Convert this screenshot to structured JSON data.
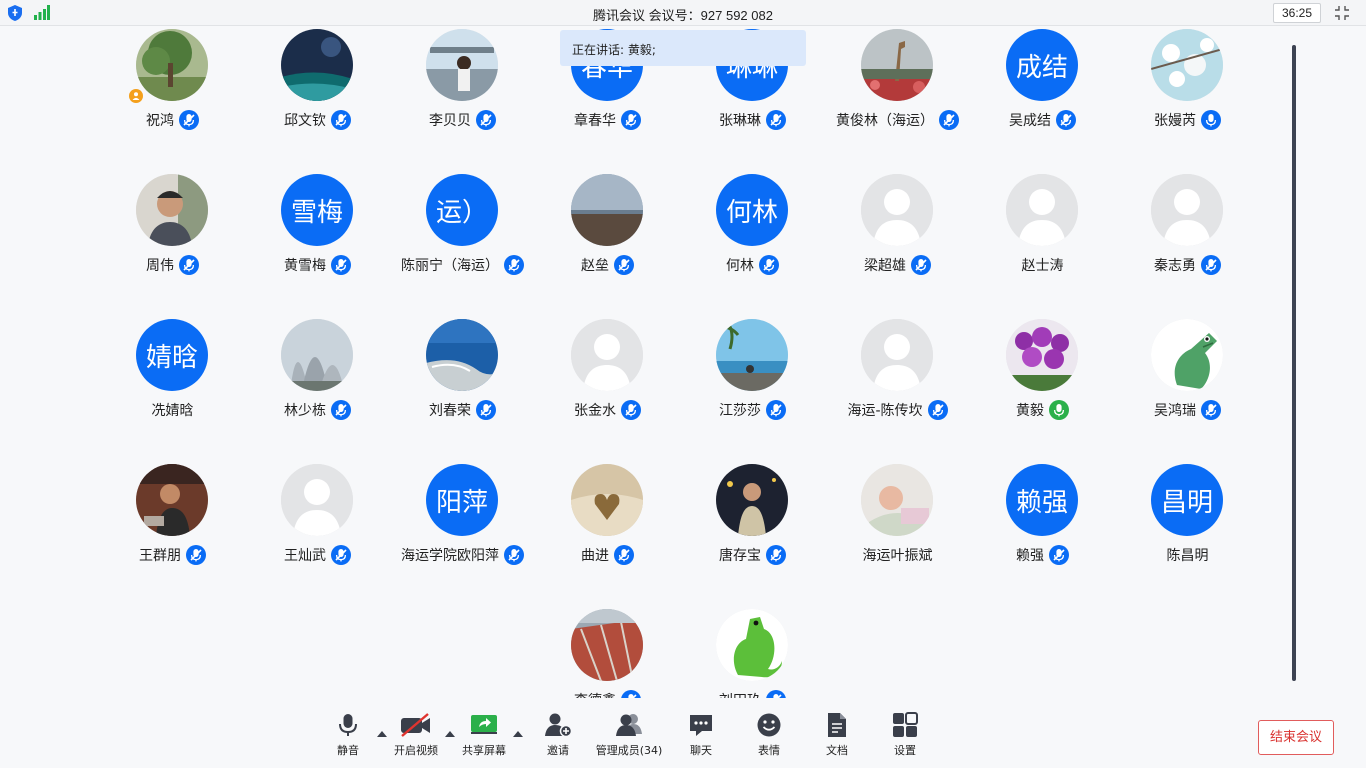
{
  "titlebar": {
    "title": "腾讯会议 会议号：927 592 082",
    "timer": "36:25"
  },
  "speaking": "正在讲话: 黄毅;",
  "participants": [
    {
      "name": "祝鸿",
      "avatar": "photo-tree",
      "mic": "muted",
      "host": true
    },
    {
      "name": "邱文钦",
      "avatar": "photo-night-sky",
      "mic": "muted"
    },
    {
      "name": "李贝贝",
      "avatar": "photo-woman-seaside",
      "mic": "muted"
    },
    {
      "name": "章春华",
      "avatar": "text",
      "avatar_text": "春华",
      "mic": "muted"
    },
    {
      "name": "张琳琳",
      "avatar": "text",
      "avatar_text": "琳琳",
      "mic": "muted"
    },
    {
      "name": "黄俊林（海运）",
      "avatar": "photo-giraffe-statue",
      "mic": "muted"
    },
    {
      "name": "吴成结",
      "avatar": "text",
      "avatar_text": "成结",
      "mic": "muted"
    },
    {
      "name": "张嫚芮",
      "avatar": "photo-blossom",
      "mic": "on"
    },
    {
      "name": "周伟",
      "avatar": "photo-man-portrait",
      "mic": "muted"
    },
    {
      "name": "黄雪梅",
      "avatar": "text",
      "avatar_text": "雪梅",
      "mic": "muted"
    },
    {
      "name": "陈丽宁（海运）",
      "avatar": "text",
      "avatar_text": "运）",
      "mic": "muted"
    },
    {
      "name": "赵垒",
      "avatar": "photo-sea-horizon",
      "mic": "muted"
    },
    {
      "name": "何林",
      "avatar": "text",
      "avatar_text": "何林",
      "mic": "muted"
    },
    {
      "name": "梁超雄",
      "avatar": "default",
      "mic": "muted"
    },
    {
      "name": "赵士涛",
      "avatar": "default",
      "mic": "none"
    },
    {
      "name": "秦志勇",
      "avatar": "default",
      "mic": "muted"
    },
    {
      "name": "冼婧晗",
      "avatar": "text",
      "avatar_text": "婧晗",
      "mic": "none"
    },
    {
      "name": "林少栋",
      "avatar": "photo-opera-house",
      "mic": "muted"
    },
    {
      "name": "刘春荣",
      "avatar": "photo-island-aerial",
      "mic": "muted"
    },
    {
      "name": "张金水",
      "avatar": "default",
      "mic": "muted"
    },
    {
      "name": "江莎莎",
      "avatar": "photo-beach-palm",
      "mic": "muted"
    },
    {
      "name": "海运-陈传坎",
      "avatar": "default",
      "mic": "muted"
    },
    {
      "name": "黄毅",
      "avatar": "photo-orchids",
      "mic": "speaking"
    },
    {
      "name": "吴鸿瑞",
      "avatar": "photo-crocodile-cartoon",
      "mic": "muted"
    },
    {
      "name": "王群朋",
      "avatar": "photo-man-reading",
      "mic": "muted"
    },
    {
      "name": "王灿武",
      "avatar": "default",
      "mic": "muted"
    },
    {
      "name": "海运学院欧阳萍",
      "avatar": "text",
      "avatar_text": "阳萍",
      "mic": "muted"
    },
    {
      "name": "曲进",
      "avatar": "photo-book-heart",
      "mic": "muted"
    },
    {
      "name": "唐存宝",
      "avatar": "photo-man-night",
      "mic": "muted"
    },
    {
      "name": "海运叶振斌",
      "avatar": "photo-baby",
      "mic": "none"
    },
    {
      "name": "赖强",
      "avatar": "text",
      "avatar_text": "赖强",
      "mic": "muted"
    },
    {
      "name": "陈昌明",
      "avatar": "text",
      "avatar_text": "昌明",
      "mic": "none"
    },
    {
      "name": "李德鑫",
      "avatar": "photo-ship-deck",
      "mic": "muted"
    },
    {
      "name": "刘田玖",
      "avatar": "photo-green-dinosaur",
      "mic": "muted"
    }
  ],
  "toolbar": {
    "items": [
      {
        "id": "mute",
        "label": "静音",
        "icon": "microphone-icon",
        "caret": true
      },
      {
        "id": "video",
        "label": "开启视频",
        "icon": "camera-off-icon",
        "caret": true
      },
      {
        "id": "share",
        "label": "共享屏幕",
        "icon": "share-screen-icon",
        "caret": true
      },
      {
        "id": "invite",
        "label": "邀请",
        "icon": "invite-user-icon"
      },
      {
        "id": "members",
        "label": "管理成员(34)",
        "icon": "members-icon"
      },
      {
        "id": "chat",
        "label": "聊天",
        "icon": "chat-icon"
      },
      {
        "id": "emoji",
        "label": "表情",
        "icon": "emoji-icon"
      },
      {
        "id": "docs",
        "label": "文档",
        "icon": "document-icon"
      },
      {
        "id": "settings",
        "label": "设置",
        "icon": "settings-icon"
      }
    ],
    "end_label": "结束会议"
  },
  "colors": {
    "accent": "#0a6cf5",
    "speaking_green": "#2bb04a",
    "danger": "#d9322f"
  }
}
